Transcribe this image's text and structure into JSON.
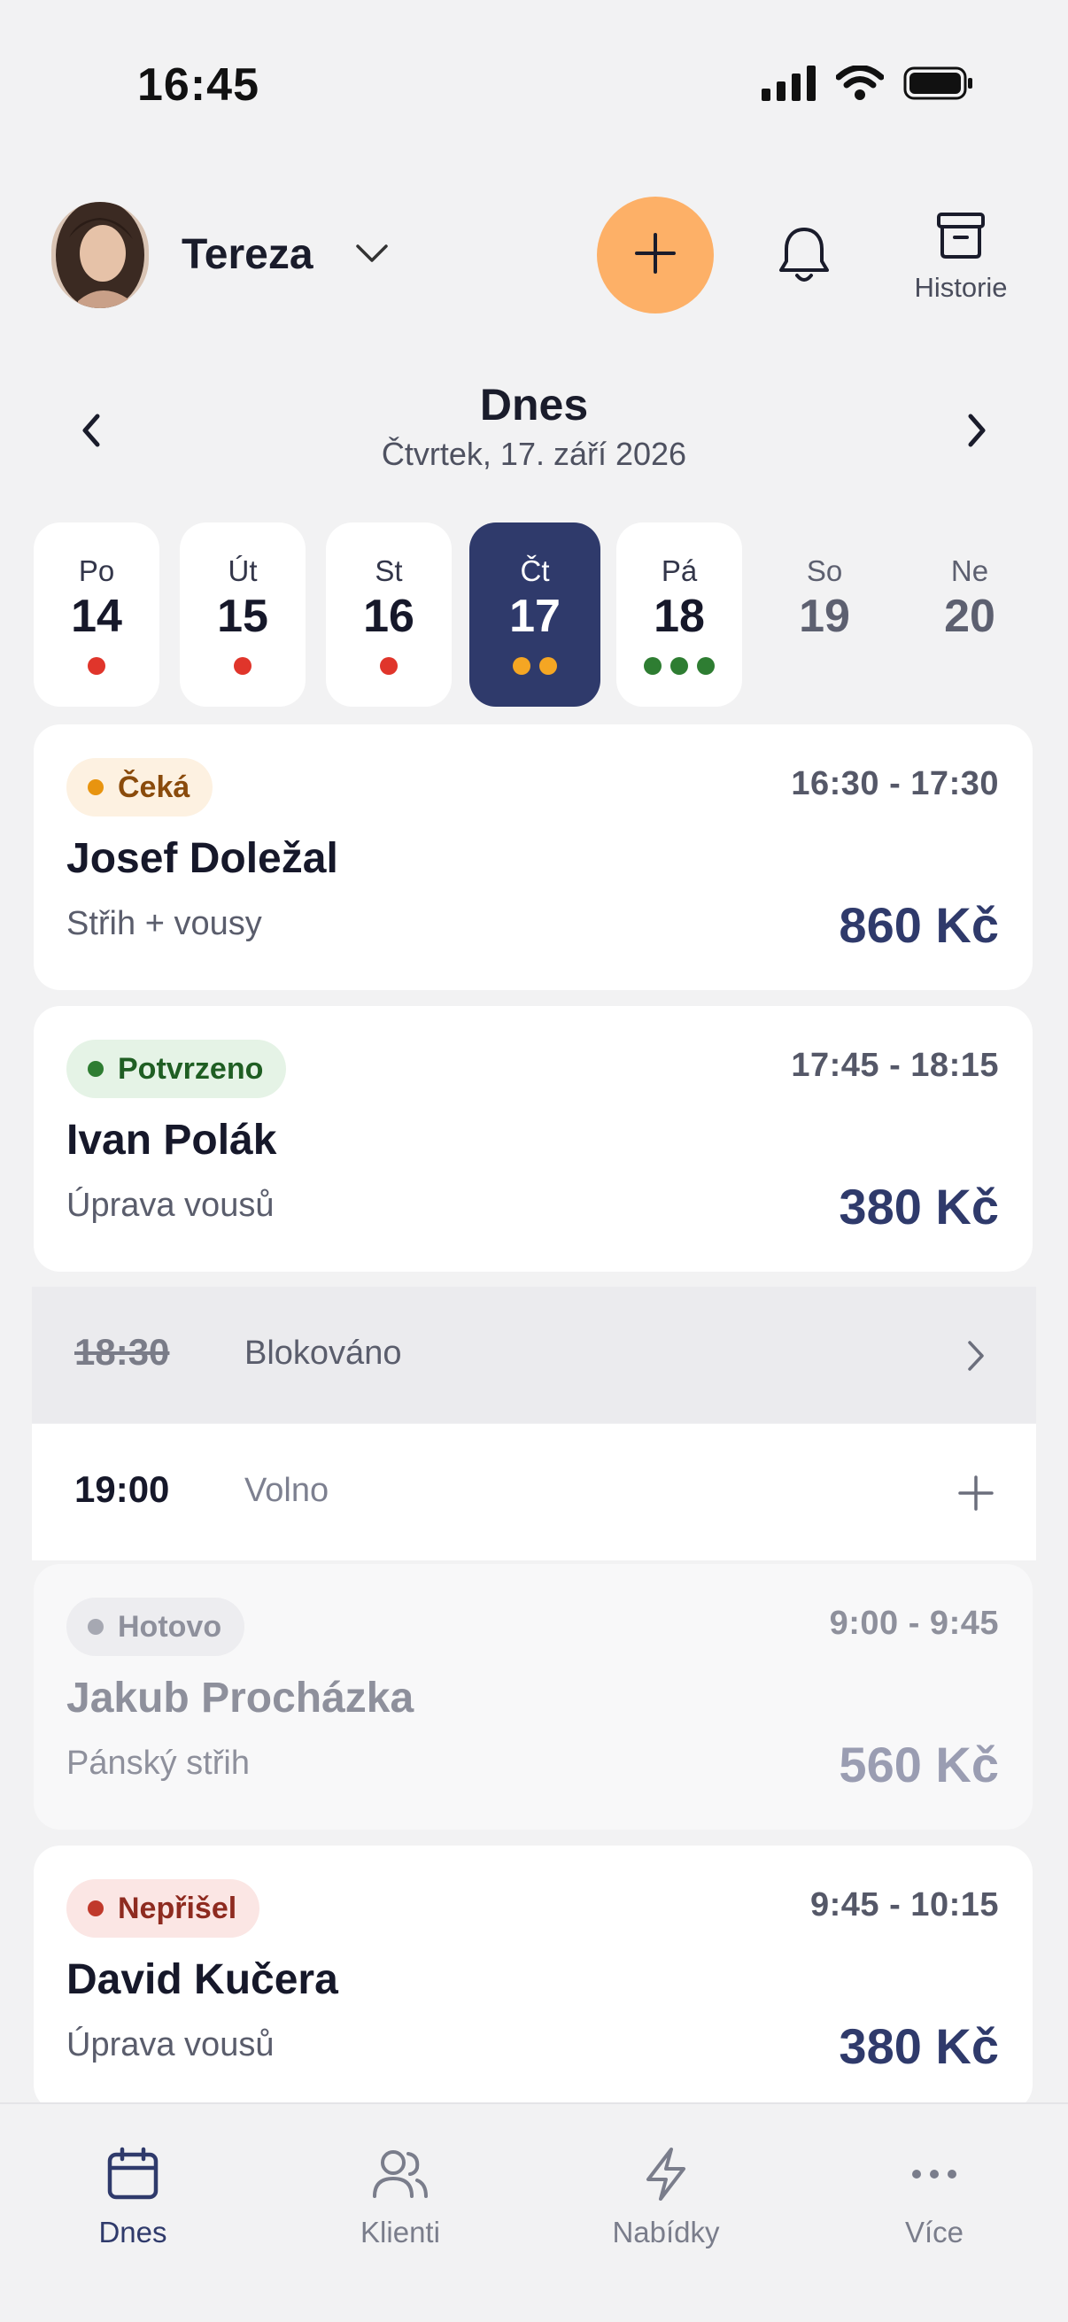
{
  "status_bar": {
    "time": "16:45"
  },
  "header": {
    "user_name": "Tereza",
    "history_label": "Historie",
    "icons": [
      "chevron-down-icon",
      "plus-icon",
      "bell-icon",
      "archive-icon"
    ],
    "accent_color": "#fdb067"
  },
  "date_nav": {
    "title": "Dnes",
    "subtitle": "Čtvrtek, 17. září 2026",
    "prev_label": "‹",
    "next_label": "›"
  },
  "week": [
    {
      "name": "Po",
      "num": "14",
      "dots": [
        "#e0352b"
      ]
    },
    {
      "name": "Út",
      "num": "15",
      "dots": [
        "#e0352b"
      ]
    },
    {
      "name": "St",
      "num": "16",
      "dots": [
        "#e0352b"
      ]
    },
    {
      "name": "Čt",
      "num": "17",
      "dots": [
        "#f5a623",
        "#f5a623"
      ],
      "active": true
    },
    {
      "name": "Pá",
      "num": "18",
      "dots": [
        "#2e7d32",
        "#2e7d32",
        "#2e7d32"
      ]
    },
    {
      "name": "So",
      "num": "19",
      "dots": []
    },
    {
      "name": "Ne",
      "num": "20",
      "dots": []
    }
  ],
  "appointments": [
    {
      "status": "Čeká",
      "status_color": "#e8940f",
      "status_bg": "#fdf1e1",
      "status_text": "#8a4b0c",
      "time": "16:30 - 17:30",
      "client": "Josef Doležal",
      "service": "Střih + vousy",
      "price": "860 Kč"
    },
    {
      "status": "Potvrzeno",
      "status_color": "#2e7d32",
      "status_bg": "#e5f3e6",
      "status_text": "#1f5e23",
      "time": "17:45 - 18:15",
      "client": "Ivan Polák",
      "service": "Úprava vousů",
      "price": "380 Kč"
    },
    {
      "status": "Hotovo",
      "status_color": "#a6a8b2",
      "status_bg": "#ededf0",
      "status_text": "#8e909c",
      "time": "9:00 - 9:45",
      "client": "Jakub Procházka",
      "service": "Pánský střih",
      "price": "560 Kč"
    },
    {
      "status": "Nepřišel",
      "status_color": "#c0392b",
      "status_bg": "#fbe6e4",
      "status_text": "#8e2b20",
      "time": "9:45 - 10:15",
      "client": "David Kučera",
      "service": "Úprava vousů",
      "price": "380 Kč"
    }
  ],
  "slots": [
    {
      "time": "18:30",
      "label": "Blokováno",
      "icon": "chevron-right-icon"
    },
    {
      "time": "19:00",
      "label": "Volno",
      "icon": "plus-icon"
    }
  ],
  "tabs": [
    {
      "label": "Dnes",
      "icon": "calendar-icon",
      "active": true
    },
    {
      "label": "Klienti",
      "icon": "users-icon"
    },
    {
      "label": "Nabídky",
      "icon": "lightning-icon"
    },
    {
      "label": "Více",
      "icon": "more-icon"
    }
  ],
  "colors": {
    "primary": "#2f3a6b",
    "background": "#f2f2f3"
  }
}
